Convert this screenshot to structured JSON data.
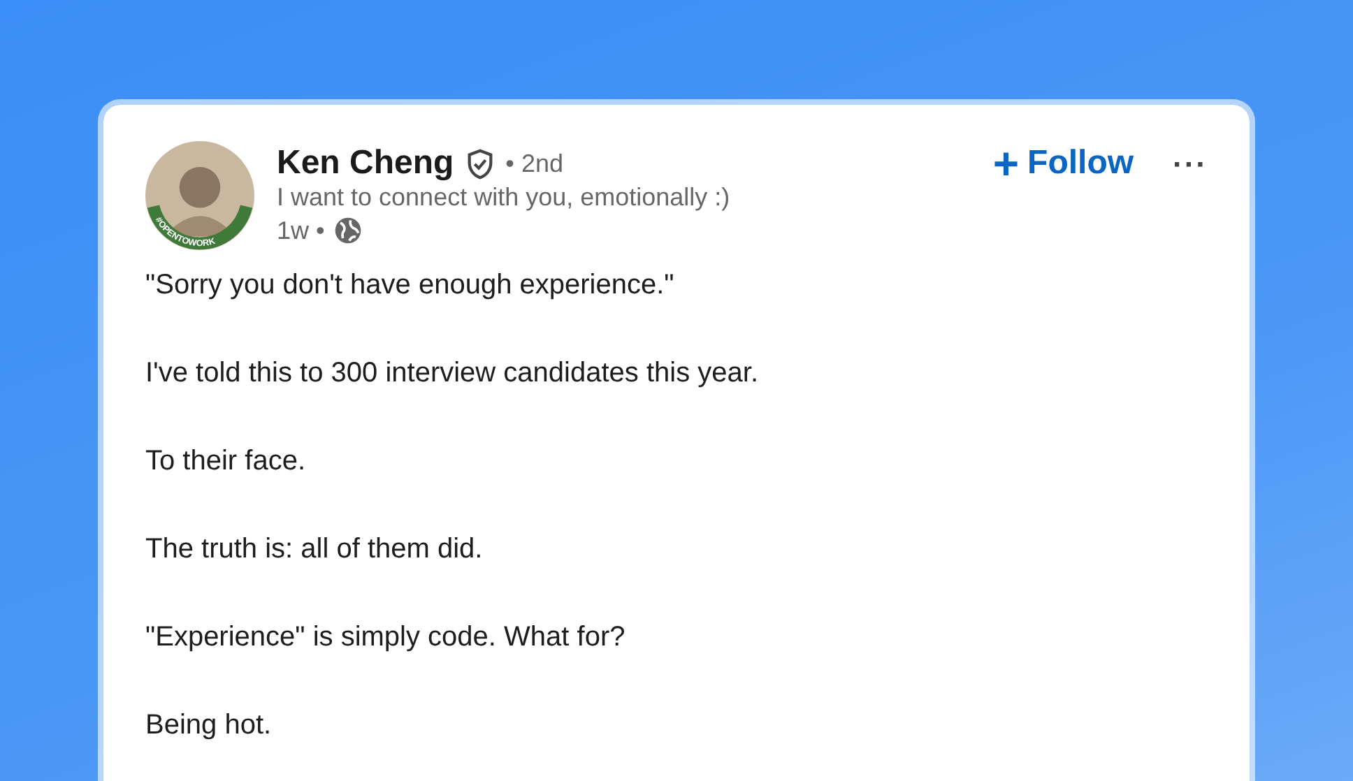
{
  "post": {
    "author": {
      "name": "Ken Cheng",
      "verified": true,
      "degree": "• 2nd",
      "headline": "I want to connect with you, emotionally :)",
      "time": "1w •",
      "avatar_badge": "#OPENTOWORK"
    },
    "follow_button": {
      "icon": "+",
      "label": "Follow"
    },
    "menu_button": "···",
    "body": [
      "\"Sorry you don't have enough experience.\"",
      "I've told this to 300 interview candidates this year.",
      "To their face.",
      "The truth is: all of them did.",
      "\"Experience\" is simply code. What for?",
      "Being hot."
    ]
  }
}
